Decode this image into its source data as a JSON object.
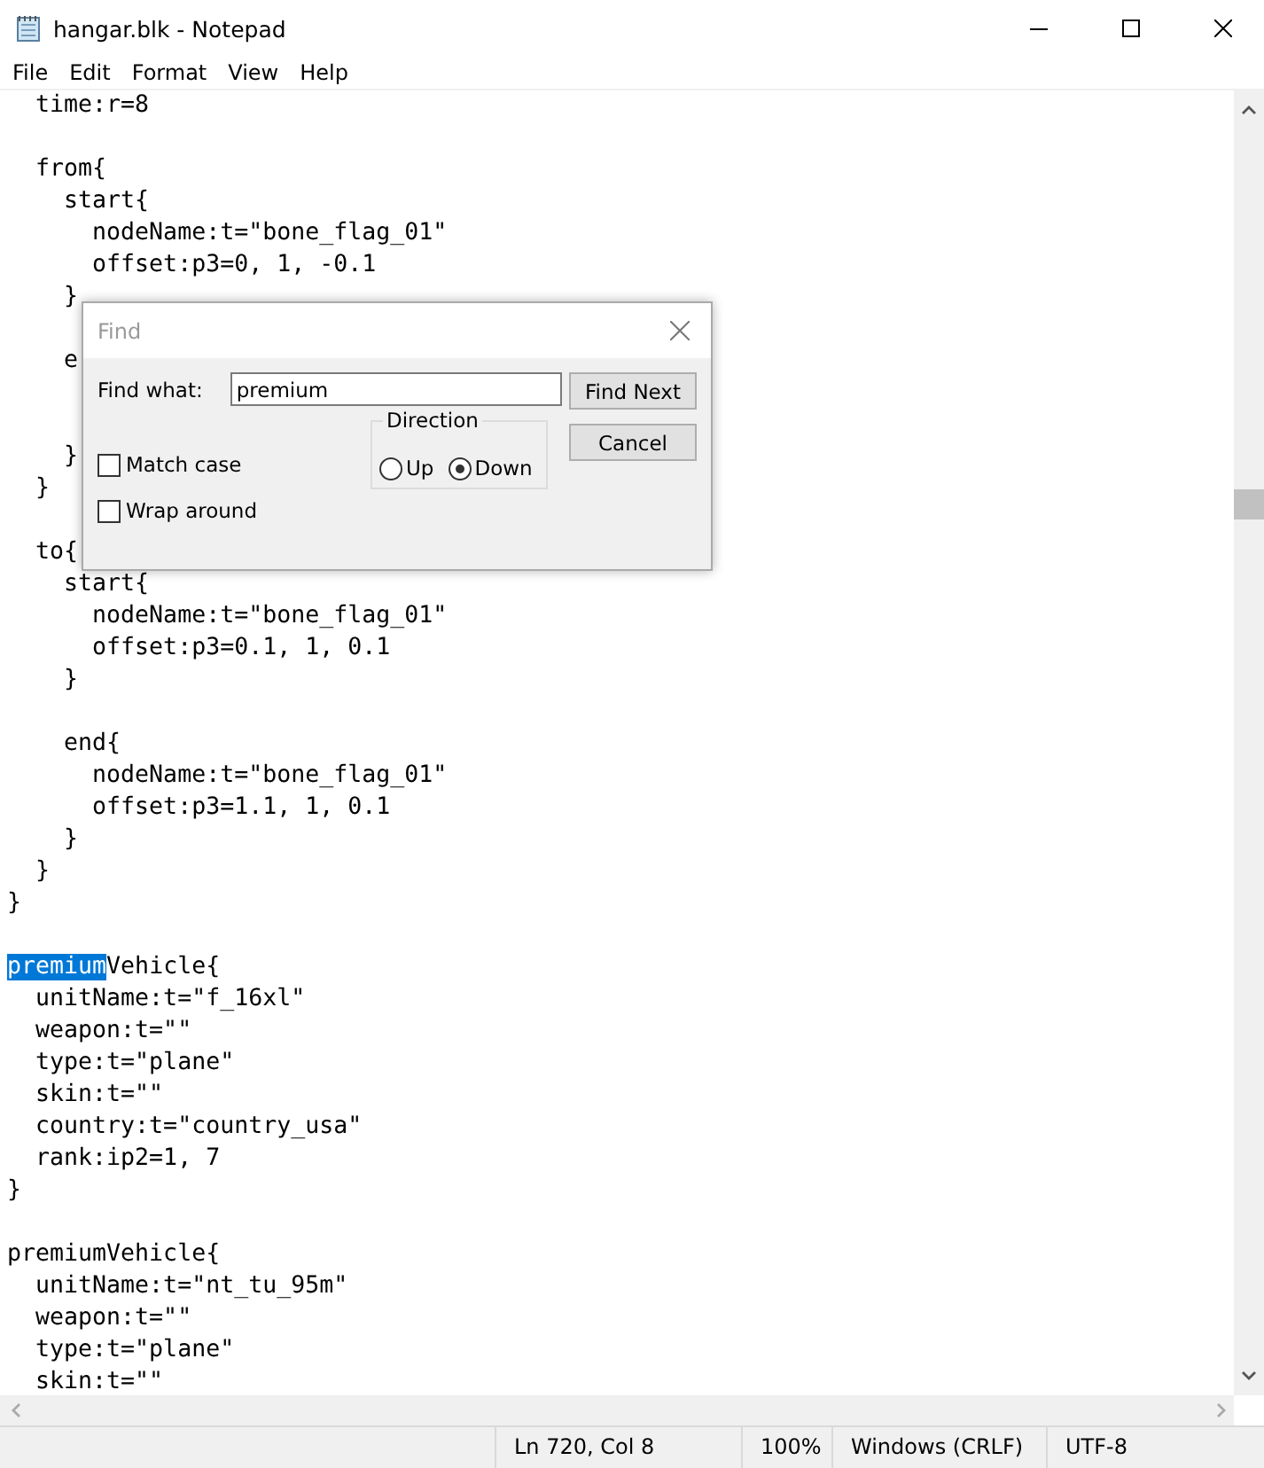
{
  "window": {
    "title": "hangar.blk - Notepad"
  },
  "menu": [
    "File",
    "Edit",
    "Format",
    "View",
    "Help"
  ],
  "editor": {
    "lines": [
      {
        "text": "  time:r=8"
      },
      {
        "text": "  from{",
        "blank_before": true
      },
      {
        "text": "    start{"
      },
      {
        "text": "      nodeName:t=\"bone_flag_01\""
      },
      {
        "text": "      offset:p3=0, 1, -0.1"
      },
      {
        "text": "    }"
      },
      {
        "text": "    e",
        "blank_before": true
      },
      {
        "text": "    }",
        "blank_before": true,
        "hidden_before": true
      },
      {
        "text": "  }"
      },
      {
        "text": "  to{",
        "blank_before": true
      },
      {
        "text": "    start{"
      },
      {
        "text": "      nodeName:t=\"bone_flag_01\""
      },
      {
        "text": "      offset:p3=0.1, 1, 0.1"
      },
      {
        "text": "    }"
      },
      {
        "text": "    end{",
        "blank_before": true
      },
      {
        "text": "      nodeName:t=\"bone_flag_01\""
      },
      {
        "text": "      offset:p3=1.1, 1, 0.1"
      },
      {
        "text": "    }"
      },
      {
        "text": "  }"
      },
      {
        "text": "}"
      },
      {
        "selected_text": "premium",
        "text": "Vehicle{",
        "blank_before": true
      },
      {
        "text": "  unitName:t=\"f_16xl\""
      },
      {
        "text": "  weapon:t=\"\""
      },
      {
        "text": "  type:t=\"plane\""
      },
      {
        "text": "  skin:t=\"\""
      },
      {
        "text": "  country:t=\"country_usa\""
      },
      {
        "text": "  rank:ip2=1, 7"
      },
      {
        "text": "}"
      },
      {
        "text": "premiumVehicle{",
        "blank_before": true
      },
      {
        "text": "  unitName:t=\"nt_tu_95m\""
      },
      {
        "text": "  weapon:t=\"\""
      },
      {
        "text": "  type:t=\"plane\""
      },
      {
        "text": "  skin:t=\"\""
      }
    ]
  },
  "find_dialog": {
    "title": "Find",
    "find_what_label": "Find what:",
    "find_what_value": "premium",
    "find_next_button": "Find Next",
    "cancel_button": "Cancel",
    "direction": {
      "label": "Direction",
      "options": [
        {
          "label": "Up",
          "selected": false
        },
        {
          "label": "Down",
          "selected": true
        }
      ]
    },
    "checkboxes": [
      {
        "label": "Match case",
        "checked": false
      },
      {
        "label": "Wrap around",
        "checked": false
      }
    ]
  },
  "status_bar": [
    "Ln 720, Col 8",
    "100%",
    "Windows (CRLF)",
    "UTF-8"
  ]
}
